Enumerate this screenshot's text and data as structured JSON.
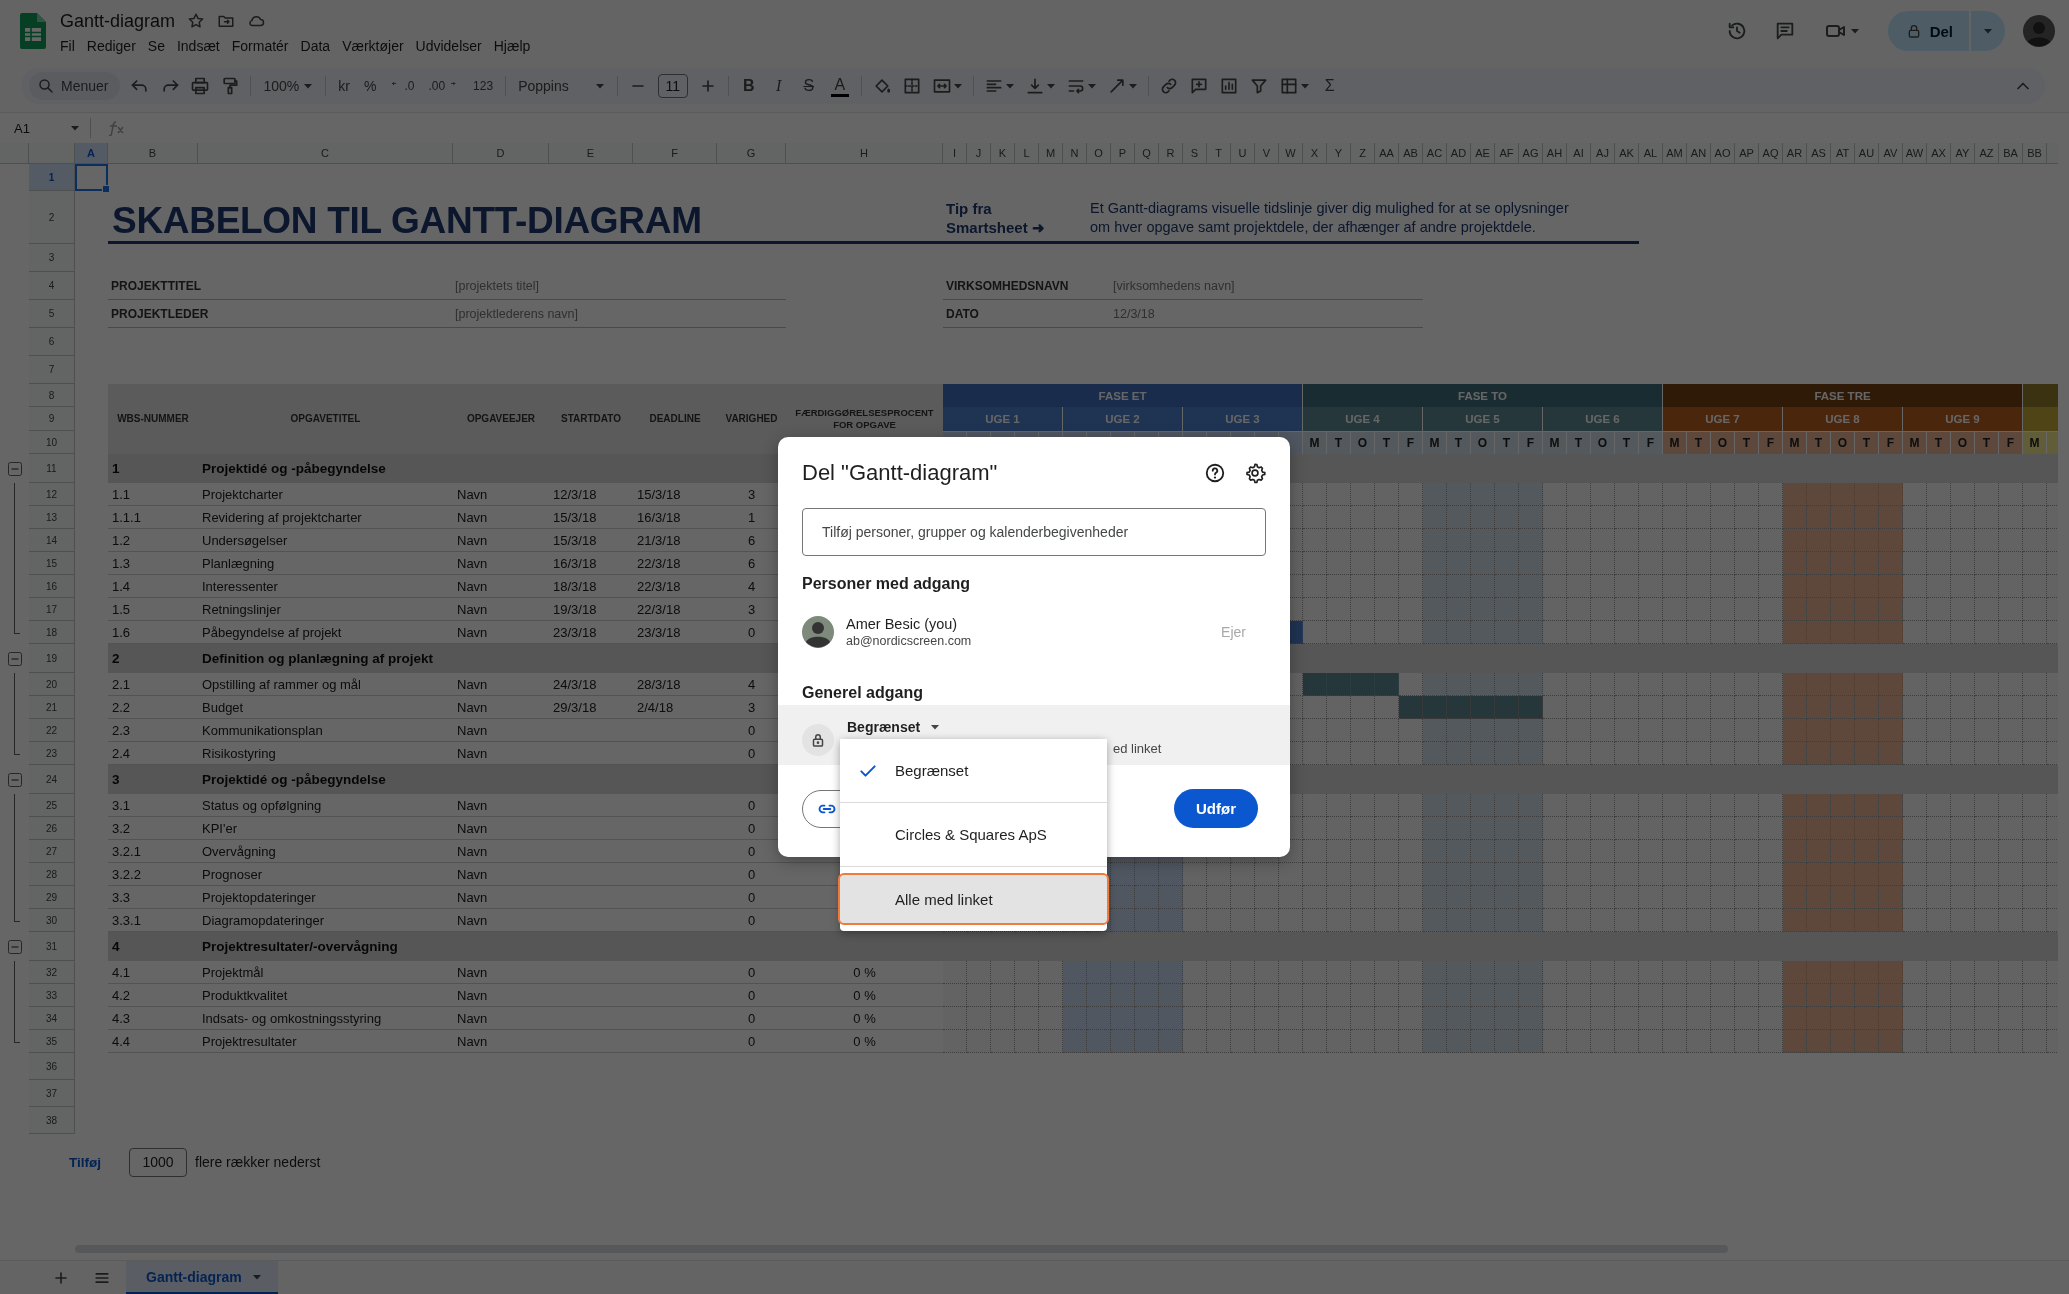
{
  "document": {
    "title": "Gantt-diagram",
    "menu": [
      "Fil",
      "Rediger",
      "Se",
      "Indsæt",
      "Formatér",
      "Data",
      "Værktøjer",
      "Udvidelser",
      "Hjælp"
    ]
  },
  "header_actions": {
    "share": "Del"
  },
  "toolbar": {
    "search": "Menuer",
    "zoom": "100%",
    "currency": "kr",
    "percent": "%",
    "decrease_decimals": ".0",
    "increase_decimals": ".00",
    "number_format": "123",
    "font": "Poppins",
    "font_size": "11",
    "bold": "B",
    "italic": "I",
    "strikethrough": "S",
    "text_color": "A",
    "functions": "Σ"
  },
  "formula_bar": {
    "cell": "A1"
  },
  "sheet": {
    "columns": [
      {
        "label": "A",
        "selected": true
      },
      {
        "label": "B",
        "selected": false
      },
      {
        "label": "C",
        "selected": false
      },
      {
        "label": "D",
        "selected": false
      },
      {
        "label": "E",
        "selected": false
      },
      {
        "label": "F",
        "selected": false
      },
      {
        "label": "G",
        "selected": false
      },
      {
        "label": "H",
        "selected": false
      },
      {
        "label": "I",
        "selected": false
      },
      {
        "label": "J",
        "selected": false
      },
      {
        "label": "K",
        "selected": false
      },
      {
        "label": "L",
        "selected": false
      },
      {
        "label": "M",
        "selected": false
      },
      {
        "label": "N",
        "selected": false
      },
      {
        "label": "O",
        "selected": false
      },
      {
        "label": "P",
        "selected": false
      },
      {
        "label": "Q",
        "selected": false
      },
      {
        "label": "R",
        "selected": false
      },
      {
        "label": "S",
        "selected": false
      },
      {
        "label": "T",
        "selected": false
      },
      {
        "label": "U",
        "selected": false
      },
      {
        "label": "V",
        "selected": false
      },
      {
        "label": "W",
        "selected": false
      },
      {
        "label": "X",
        "selected": false
      },
      {
        "label": "Y",
        "selected": false
      },
      {
        "label": "Z",
        "selected": false
      },
      {
        "label": "AA",
        "selected": false
      },
      {
        "label": "AB",
        "selected": false
      },
      {
        "label": "AC",
        "selected": false
      },
      {
        "label": "AD",
        "selected": false
      },
      {
        "label": "AE",
        "selected": false
      },
      {
        "label": "AF",
        "selected": false
      },
      {
        "label": "AG",
        "selected": false
      },
      {
        "label": "AH",
        "selected": false
      },
      {
        "label": "AI",
        "selected": false
      },
      {
        "label": "AJ",
        "selected": false
      },
      {
        "label": "AK",
        "selected": false
      },
      {
        "label": "AL",
        "selected": false
      },
      {
        "label": "AM",
        "selected": false
      },
      {
        "label": "AN",
        "selected": false
      },
      {
        "label": "AO",
        "selected": false
      },
      {
        "label": "AP",
        "selected": false
      },
      {
        "label": "AQ",
        "selected": false
      },
      {
        "label": "AR",
        "selected": false
      },
      {
        "label": "AS",
        "selected": false
      },
      {
        "label": "AT",
        "selected": false
      },
      {
        "label": "AU",
        "selected": false
      },
      {
        "label": "AV",
        "selected": false
      },
      {
        "label": "AW",
        "selected": false
      },
      {
        "label": "AX",
        "selected": false
      },
      {
        "label": "AY",
        "selected": false
      },
      {
        "label": "AZ",
        "selected": false
      },
      {
        "label": "BA",
        "selected": false
      },
      {
        "label": "BB",
        "selected": false
      }
    ],
    "rows": [
      {
        "label": "1",
        "selected": true
      },
      {
        "label": "2",
        "selected": false
      },
      {
        "label": "3",
        "selected": false
      },
      {
        "label": "4",
        "selected": false
      },
      {
        "label": "5",
        "selected": false
      },
      {
        "label": "6",
        "selected": false
      },
      {
        "label": "7",
        "selected": false
      },
      {
        "label": "8",
        "selected": false
      },
      {
        "label": "9",
        "selected": false
      },
      {
        "label": "10",
        "selected": false
      },
      {
        "label": "11",
        "selected": false
      },
      {
        "label": "12",
        "selected": false
      },
      {
        "label": "13",
        "selected": false
      },
      {
        "label": "14",
        "selected": false
      },
      {
        "label": "15",
        "selected": false
      },
      {
        "label": "16",
        "selected": false
      },
      {
        "label": "17",
        "selected": false
      },
      {
        "label": "18",
        "selected": false
      },
      {
        "label": "19",
        "selected": false
      },
      {
        "label": "20",
        "selected": false
      },
      {
        "label": "21",
        "selected": false
      },
      {
        "label": "22",
        "selected": false
      },
      {
        "label": "23",
        "selected": false
      },
      {
        "label": "24",
        "selected": false
      },
      {
        "label": "25",
        "selected": false
      },
      {
        "label": "26",
        "selected": false
      },
      {
        "label": "27",
        "selected": false
      },
      {
        "label": "28",
        "selected": false
      },
      {
        "label": "29",
        "selected": false
      },
      {
        "label": "30",
        "selected": false
      },
      {
        "label": "31",
        "selected": false
      },
      {
        "label": "32",
        "selected": false
      },
      {
        "label": "33",
        "selected": false
      },
      {
        "label": "34",
        "selected": false
      },
      {
        "label": "35",
        "selected": false
      },
      {
        "label": "36",
        "selected": false
      },
      {
        "label": "37",
        "selected": false
      },
      {
        "label": "38",
        "selected": false
      }
    ],
    "title": "SKABELON TIL GANTT-DIAGRAM",
    "tip": "Tip fra\nSmartsheet ➜",
    "description": "Et Gantt-diagrams visuelle tidslinje giver dig mulighed for at se oplysninger\nom hver opgave samt projektdele, der afhænger af andre projektdele.",
    "project_fields": [
      {
        "label": "PROJEKTTITEL",
        "value": "[projektets titel]"
      },
      {
        "label": "PROJEKTLEDER",
        "value": "[projektlederens navn]"
      }
    ],
    "company_fields": [
      {
        "label": "VIRKSOMHEDSNAVN",
        "value": "[virksomhedens navn]"
      },
      {
        "label": "DATO",
        "value": "12/3/18"
      }
    ],
    "table": {
      "columns": [
        "WBS-NUMMER",
        "OPGAVETITEL",
        "OPGAVEEJER",
        "STARTDATO",
        "DEADLINE",
        "VARIGHED",
        "FÆRDIGGØRELSESPROCENT\nFOR OPGAVE"
      ],
      "groups": [
        {
          "number": "1",
          "title": "Projektidé og -påbegyndelse",
          "expanded": true,
          "tasks": [
            {
              "wbs": "1.1",
              "title": "Projektcharter",
              "owner": "Navn",
              "start": "12/3/18",
              "deadline": "15/3/18",
              "duration": "3"
            },
            {
              "wbs": "1.1.1",
              "title": "Revidering af projektcharter",
              "owner": "Navn",
              "start": "15/3/18",
              "deadline": "16/3/18",
              "duration": "1"
            },
            {
              "wbs": "1.2",
              "title": "Undersøgelser",
              "owner": "Navn",
              "start": "15/3/18",
              "deadline": "21/3/18",
              "duration": "6"
            },
            {
              "wbs": "1.3",
              "title": "Planlægning",
              "owner": "Navn",
              "start": "16/3/18",
              "deadline": "22/3/18",
              "duration": "6"
            },
            {
              "wbs": "1.4",
              "title": "Interessenter",
              "owner": "Navn",
              "start": "18/3/18",
              "deadline": "22/3/18",
              "duration": "4"
            },
            {
              "wbs": "1.5",
              "title": "Retningslinjer",
              "owner": "Navn",
              "start": "19/3/18",
              "deadline": "22/3/18",
              "duration": "3"
            },
            {
              "wbs": "1.6",
              "title": "Påbegyndelse af projekt",
              "owner": "Navn",
              "start": "23/3/18",
              "deadline": "23/3/18",
              "duration": "0",
              "filled_days": [
                false,
                false,
                false,
                false,
                false,
                false,
                false,
                false,
                false,
                false,
                false,
                false,
                false,
                false,
                true
              ]
            }
          ]
        },
        {
          "number": "2",
          "title": "Definition og planlægning af projekt",
          "expanded": true,
          "tasks": [
            {
              "wbs": "2.1",
              "title": "Opstilling af rammer og mål",
              "owner": "Navn",
              "start": "24/3/18",
              "deadline": "28/3/18",
              "duration": "4",
              "filled_days": [
                false,
                false,
                false,
                false,
                false,
                false,
                false,
                false,
                false,
                false,
                false,
                false,
                false,
                false,
                false,
                true,
                true,
                true,
                true
              ]
            },
            {
              "wbs": "2.2",
              "title": "Budget",
              "owner": "Navn",
              "start": "29/3/18",
              "deadline": "2/4/18",
              "duration": "3",
              "filled_days": [
                false,
                false,
                false,
                false,
                false,
                false,
                false,
                false,
                false,
                false,
                false,
                false,
                false,
                false,
                false,
                false,
                false,
                false,
                false,
                true,
                true,
                true,
                true,
                true,
                true
              ]
            },
            {
              "wbs": "2.3",
              "title": "Kommunikationsplan",
              "owner": "Navn",
              "duration": "0"
            },
            {
              "wbs": "2.4",
              "title": "Risikostyring",
              "owner": "Navn",
              "duration": "0"
            }
          ]
        },
        {
          "number": "3",
          "title": "Projektidé og -påbegyndelse",
          "expanded": true,
          "tasks": [
            {
              "wbs": "3.1",
              "title": "Status og opfølgning",
              "owner": "Navn",
              "duration": "0"
            },
            {
              "wbs": "3.2",
              "title": "KPI'er",
              "owner": "Navn",
              "duration": "0"
            },
            {
              "wbs": "3.2.1",
              "title": "Overvågning",
              "owner": "Navn",
              "duration": "0"
            },
            {
              "wbs": "3.2.2",
              "title": "Prognoser",
              "owner": "Navn",
              "duration": "0"
            },
            {
              "wbs": "3.3",
              "title": "Projektopdateringer",
              "owner": "Navn",
              "duration": "0"
            },
            {
              "wbs": "3.3.1",
              "title": "Diagramopdateringer",
              "owner": "Navn",
              "duration": "0"
            }
          ]
        },
        {
          "number": "4",
          "title": "Projektresultater/-overvågning",
          "expanded": true,
          "tasks": [
            {
              "wbs": "4.1",
              "title": "Projektmål",
              "owner": "Navn",
              "duration": "0",
              "percent": "0 %"
            },
            {
              "wbs": "4.2",
              "title": "Produktkvalitet",
              "owner": "Navn",
              "duration": "0",
              "percent": "0 %"
            },
            {
              "wbs": "4.3",
              "title": "Indsats- og omkostningsstyring",
              "owner": "Navn",
              "duration": "0",
              "percent": "0 %"
            },
            {
              "wbs": "4.4",
              "title": "Projektresultater",
              "owner": "Navn",
              "duration": "0",
              "percent": "0 %"
            }
          ]
        }
      ]
    },
    "timeline": {
      "phases": [
        {
          "label": "FASE ET",
          "kind": "blue",
          "weeks": [
            {
              "label": "UGE 1",
              "shaded": false
            },
            {
              "label": "UGE 2",
              "shaded": true
            },
            {
              "label": "UGE 3",
              "shaded": false
            }
          ]
        },
        {
          "label": "FASE TO",
          "kind": "teal",
          "weeks": [
            {
              "label": "UGE 4",
              "shaded": false,
              "days": [
                "M",
                "T",
                "O",
                "T",
                "F"
              ]
            },
            {
              "label": "UGE 5",
              "shaded": true,
              "days": [
                "M",
                "T",
                "O",
                "T",
                "F"
              ]
            },
            {
              "label": "UGE 6",
              "shaded": false,
              "days": [
                "M",
                "T",
                "O",
                "T",
                "F"
              ]
            }
          ]
        },
        {
          "label": "FASE TRE",
          "kind": "brown",
          "weeks": [
            {
              "label": "UGE 7",
              "shaded": false,
              "days": [
                "M",
                "T",
                "O",
                "T",
                "F"
              ]
            },
            {
              "label": "UGE 8",
              "shaded": true,
              "days": [
                "M",
                "T",
                "O",
                "T",
                "F"
              ]
            },
            {
              "label": "UGE 9",
              "shaded": false,
              "days": [
                "M",
                "T",
                "O",
                "T",
                "F"
              ]
            }
          ]
        },
        {
          "kind": "olive",
          "weeks": [
            {
              "shaded": false,
              "days": [
                "M"
              ]
            }
          ]
        }
      ]
    }
  },
  "add_rows": {
    "button": "Tilføj",
    "count": "1000",
    "text": "flere rækker nederst"
  },
  "sheet_tabs": [
    {
      "label": "Gantt-diagram",
      "selected": true
    }
  ],
  "share_dialog": {
    "title": "Del \"Gantt-diagram\"",
    "placeholder": "Tilføj personer, grupper og kalenderbegivenheder",
    "people_heading": "Personer med adgang",
    "people": [
      {
        "name": "Amer Besic (you)",
        "email": "ab@nordicscreen.com",
        "role": "Ejer"
      }
    ],
    "general_heading": "Generel adgang",
    "access": "Begrænset",
    "access_description": "ed linket",
    "access_options": [
      {
        "label": "Begrænset",
        "selected": true,
        "highlighted": false
      },
      {
        "label": "Circles & Squares ApS",
        "selected": false,
        "highlighted": false
      },
      {
        "label": "Alle med linket",
        "selected": false,
        "highlighted": true
      }
    ],
    "done_button": "Udfør"
  }
}
